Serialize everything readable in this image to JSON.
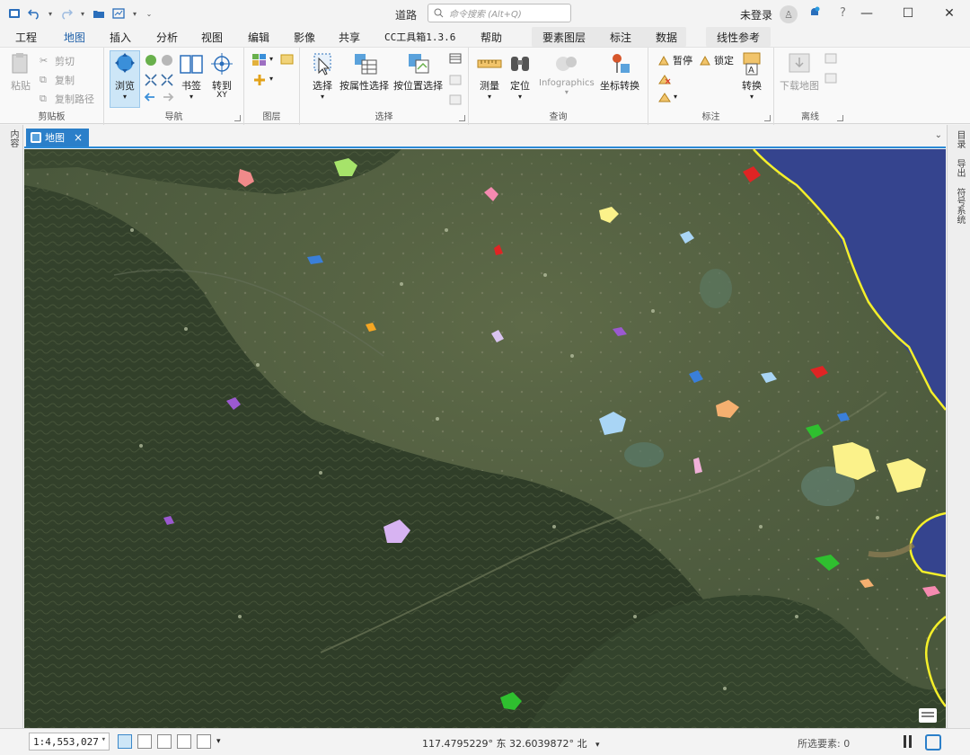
{
  "window": {
    "title": "道路",
    "search_placeholder": "命令搜索 (Alt+Q)",
    "user_label": "未登录",
    "help_label": "?"
  },
  "tabs": [
    {
      "label": "工程"
    },
    {
      "label": "地图"
    },
    {
      "label": "插入"
    },
    {
      "label": "分析"
    },
    {
      "label": "视图"
    },
    {
      "label": "编辑"
    },
    {
      "label": "影像"
    },
    {
      "label": "共享"
    },
    {
      "label": "CC工具箱1.3.6"
    },
    {
      "label": "帮助"
    },
    {
      "label": "要素图层"
    },
    {
      "label": "标注"
    },
    {
      "label": "数据"
    },
    {
      "label": "线性参考"
    }
  ],
  "ribbon": {
    "clipboard": {
      "label": "剪贴板",
      "paste": "粘贴",
      "cut": "剪切",
      "copy": "复制",
      "copy_path": "复制路径"
    },
    "navigate": {
      "label": "导航",
      "explore": "浏览",
      "bookmarks": "书签",
      "goto": "转到",
      "goto_sub": "XY"
    },
    "layer": {
      "label": "图层"
    },
    "selection": {
      "label": "选择",
      "select": "选择",
      "select_by_attr": "按属性选择",
      "select_by_loc": "按位置选择"
    },
    "inquiry": {
      "label": "查询",
      "measure": "测量",
      "locate": "定位",
      "infographics": "Infographics",
      "convert_coords": "坐标转换"
    },
    "labeling": {
      "label": "标注",
      "pause": "暂停",
      "lock": "锁定",
      "convert": "转换"
    },
    "offline": {
      "label": "离线",
      "download_map": "下载地图"
    }
  },
  "side": {
    "left_dock": "内容",
    "right_catalog": "目录",
    "right_export": "导出",
    "right_symbology": "符号系统"
  },
  "doc_tab": {
    "label": "地图",
    "close": "×"
  },
  "status": {
    "scale": "1:4,553,027",
    "coords": "117.4795229° 东  32.6039872° 北",
    "selected_label": "所选要素: 0"
  }
}
